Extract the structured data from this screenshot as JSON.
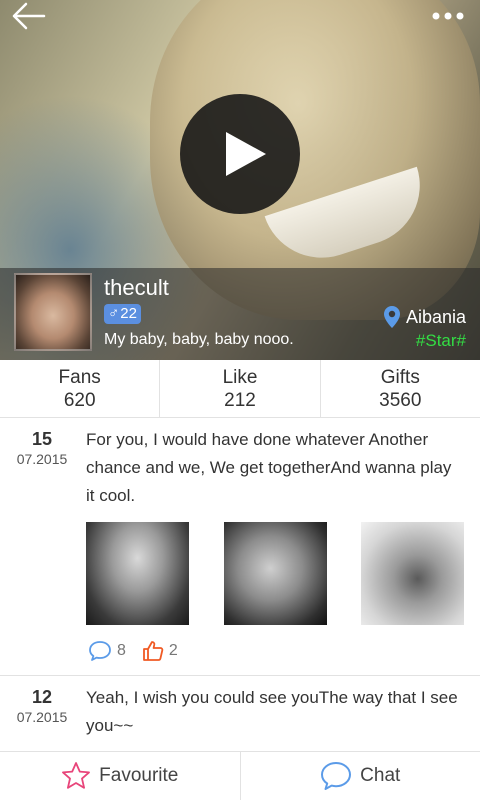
{
  "header": {
    "back_icon": "arrow-left-icon",
    "more_icon": "more-dots-icon"
  },
  "video": {
    "play_icon": "play-icon"
  },
  "profile": {
    "username": "thecult",
    "gender_symbol": "♂",
    "age": "22",
    "bio": "My baby, baby, baby nooo.",
    "location": "Aibania",
    "tag": "#Star#"
  },
  "stats": [
    {
      "label": "Fans",
      "value": "620"
    },
    {
      "label": "Like",
      "value": "212"
    },
    {
      "label": "Gifts",
      "value": "3560"
    }
  ],
  "posts": [
    {
      "day": "15",
      "month": "07.2015",
      "text": "For you, I would have done whatever Another chance and we, We get togetherAnd wanna play it cool.",
      "comments": "8",
      "likes": "2"
    },
    {
      "day": "12",
      "month": "07.2015",
      "text": "Yeah, I wish you could see youThe way that I see you~~"
    }
  ],
  "bottom": {
    "favourite_label": "Favourite",
    "chat_label": "Chat"
  },
  "colors": {
    "accent_blue": "#5b9be8",
    "tag_green": "#33dd44",
    "like_orange": "#f05a24",
    "star_pink": "#e8457a"
  }
}
